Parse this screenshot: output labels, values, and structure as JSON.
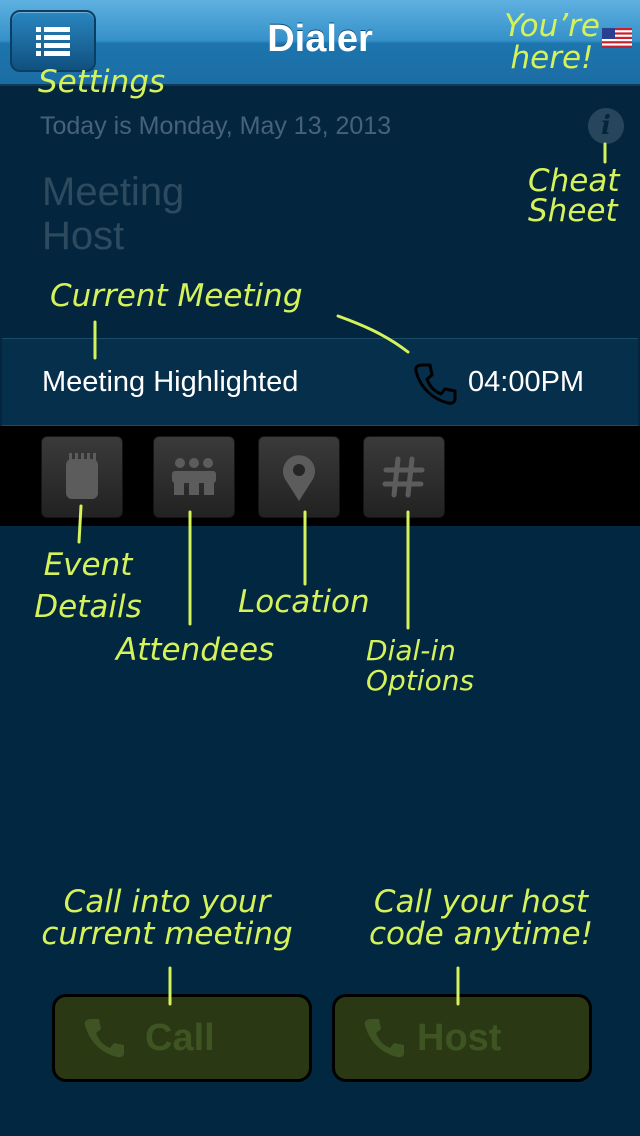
{
  "header": {
    "title": "Dialer",
    "menu_icon": "list-icon",
    "flag_icon": "us-flag-icon"
  },
  "info": {
    "date_text": "Today is Monday, May 13, 2013",
    "info_icon_glyph": "i",
    "host_label_line1": "Meeting",
    "host_label_line2": "Host"
  },
  "meeting": {
    "name": "Meeting Highlighted",
    "time": "04:00PM",
    "phone_icon": "phone-icon"
  },
  "actions": [
    {
      "icon": "notepad-icon"
    },
    {
      "icon": "attendees-icon"
    },
    {
      "icon": "map-pin-icon"
    },
    {
      "icon": "hash-icon"
    }
  ],
  "buttons": {
    "call_label": "Call",
    "host_label": "Host"
  },
  "annotations": {
    "settings": "Settings",
    "youre_here_line1": "You’re",
    "youre_here_line2": "here!",
    "cheat_line1": "Cheat",
    "cheat_line2": "Sheet",
    "current_meeting": "Current Meeting",
    "event_line1": "Event",
    "event_line2": "Details",
    "attendees": "Attendees",
    "location": "Location",
    "dialin_line1": "Dial-in",
    "dialin_line2": "Options",
    "call_note_line1": "Call into your",
    "call_note_line2": "current meeting",
    "host_note_line1": "Call your host",
    "host_note_line2": "code anytime!"
  },
  "colors": {
    "annotation": "#d5f25a",
    "header_blue": "#3591c9",
    "background": "#03263e"
  }
}
